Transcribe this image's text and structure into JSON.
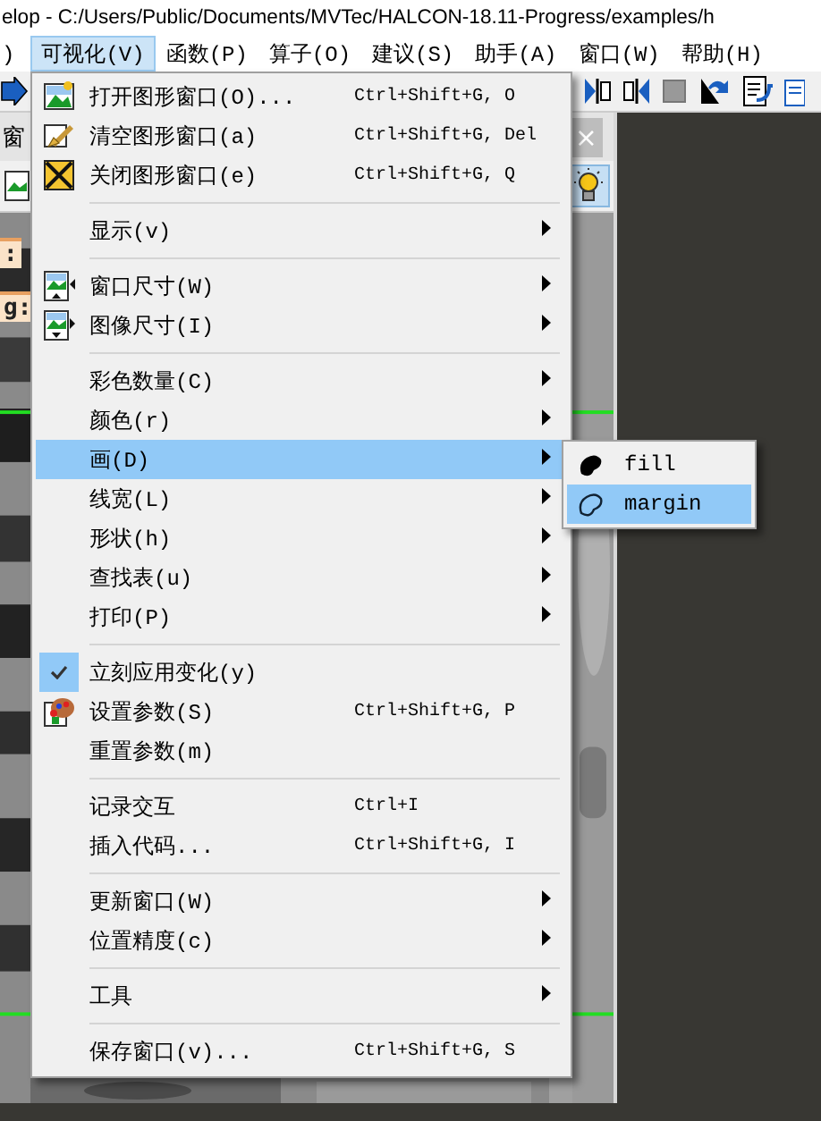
{
  "title_bar": {
    "text": "elop - C:/Users/Public/Documents/MVTec/HALCON-18.11-Progress/examples/h"
  },
  "menubar": [
    {
      "label": ")",
      "selected": false
    },
    {
      "label": "可视化(V)",
      "selected": true
    },
    {
      "label": "函数(P)",
      "selected": false
    },
    {
      "label": "算子(O)",
      "selected": false
    },
    {
      "label": "建议(S)",
      "selected": false
    },
    {
      "label": "助手(A)",
      "selected": false
    },
    {
      "label": "窗口(W)",
      "selected": false
    },
    {
      "label": "帮助(H)",
      "selected": false
    }
  ],
  "workspace": {
    "tab_label": "窗",
    "tab_close": "×",
    "panel_labels": [
      ":",
      "g:"
    ]
  },
  "menu": {
    "items": [
      {
        "kind": "item",
        "label": "打开图形窗口(O)...",
        "shortcut": "Ctrl+Shift+G, O",
        "submenu": false,
        "checked": false,
        "selected": false
      },
      {
        "kind": "item",
        "label": "清空图形窗口(a)",
        "shortcut": "Ctrl+Shift+G, Del",
        "submenu": false,
        "checked": false,
        "selected": false
      },
      {
        "kind": "item",
        "label": "关闭图形窗口(e)",
        "shortcut": "Ctrl+Shift+G, Q",
        "submenu": false,
        "checked": false,
        "selected": false
      },
      {
        "kind": "separator"
      },
      {
        "kind": "item",
        "label": "显示(v)",
        "submenu": true,
        "checked": false,
        "selected": false
      },
      {
        "kind": "separator"
      },
      {
        "kind": "item",
        "label": "窗口尺寸(W)",
        "submenu": true,
        "checked": false,
        "selected": false
      },
      {
        "kind": "item",
        "label": "图像尺寸(I)",
        "submenu": true,
        "checked": false,
        "selected": false
      },
      {
        "kind": "separator"
      },
      {
        "kind": "item",
        "label": "彩色数量(C)",
        "submenu": true,
        "checked": false,
        "selected": false
      },
      {
        "kind": "item",
        "label": "颜色(r)",
        "submenu": true,
        "checked": false,
        "selected": false
      },
      {
        "kind": "item",
        "label": "画(D)",
        "submenu": true,
        "checked": false,
        "selected": true
      },
      {
        "kind": "item",
        "label": "线宽(L)",
        "submenu": true,
        "checked": false,
        "selected": false
      },
      {
        "kind": "item",
        "label": "形状(h)",
        "submenu": true,
        "checked": false,
        "selected": false
      },
      {
        "kind": "item",
        "label": "查找表(u)",
        "submenu": true,
        "checked": false,
        "selected": false
      },
      {
        "kind": "item",
        "label": "打印(P)",
        "submenu": true,
        "checked": false,
        "selected": false
      },
      {
        "kind": "separator"
      },
      {
        "kind": "item",
        "label": "立刻应用变化(y)",
        "submenu": false,
        "checked": true,
        "selected": false
      },
      {
        "kind": "item",
        "label": "设置参数(S)",
        "shortcut": "Ctrl+Shift+G, P",
        "submenu": false,
        "checked": false,
        "selected": false
      },
      {
        "kind": "item",
        "label": "重置参数(m)",
        "submenu": false,
        "checked": false,
        "selected": false
      },
      {
        "kind": "separator"
      },
      {
        "kind": "item",
        "label": "记录交互",
        "shortcut": "Ctrl+I",
        "submenu": false,
        "checked": false,
        "selected": false
      },
      {
        "kind": "item",
        "label": "插入代码...",
        "shortcut": "Ctrl+Shift+G, I",
        "submenu": false,
        "checked": false,
        "selected": false
      },
      {
        "kind": "separator"
      },
      {
        "kind": "item",
        "label": "更新窗口(W)",
        "submenu": true,
        "checked": false,
        "selected": false
      },
      {
        "kind": "item",
        "label": "位置精度(c)",
        "submenu": true,
        "checked": false,
        "selected": false
      },
      {
        "kind": "separator"
      },
      {
        "kind": "item",
        "label": "工具",
        "submenu": true,
        "checked": false,
        "selected": false
      },
      {
        "kind": "separator"
      },
      {
        "kind": "item",
        "label": "保存窗口(v)...",
        "shortcut": "Ctrl+Shift+G, S",
        "submenu": false,
        "checked": false,
        "selected": false
      }
    ]
  },
  "submenu": {
    "items": [
      {
        "label": "fill",
        "selected": false
      },
      {
        "label": "margin",
        "selected": true
      }
    ]
  }
}
